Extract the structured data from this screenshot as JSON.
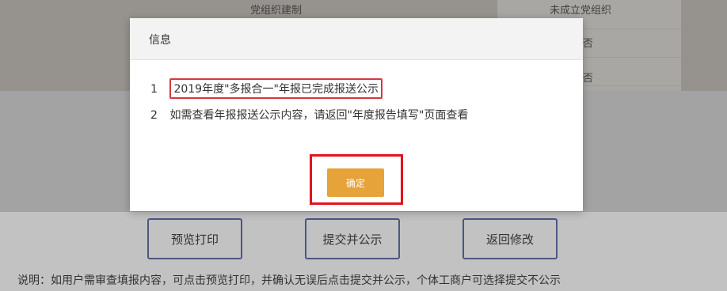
{
  "background": {
    "table_cell_center": "党组织建制",
    "table_cell_right_top": "未成立党组织",
    "right_col_row2": "否",
    "right_col_row3": "否"
  },
  "actions": {
    "preview_print": "预览打印",
    "submit_publish": "提交并公示",
    "back_edit": "返回修改"
  },
  "note": "说明：如用户需审查填报内容，可点击预览打印，并确认无误后点击提交并公示，个体工商户可选择提交不公示",
  "dialog": {
    "title": "信息",
    "messages": [
      {
        "num": "1",
        "text": "2019年度\"多报合一\"年报已完成报送公示"
      },
      {
        "num": "2",
        "text": "如需查看年报报送公示内容，请返回\"年度报告填写\"页面查看"
      }
    ],
    "confirm_label": "确定"
  },
  "colors": {
    "confirm_button": "#e6a33a",
    "highlight_red": "#e0141c",
    "button_border": "#4a5a9c"
  }
}
